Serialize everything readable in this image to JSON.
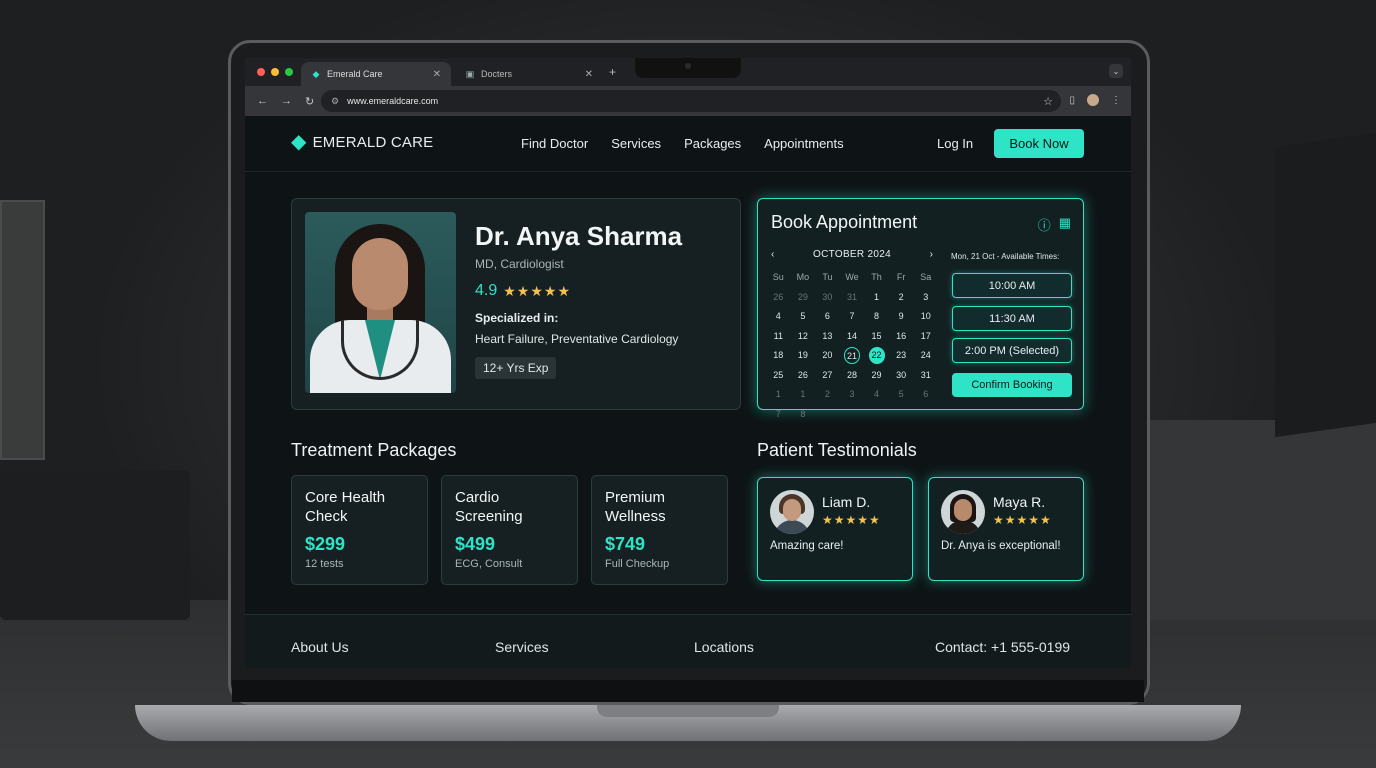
{
  "browser": {
    "tabs": [
      {
        "label": "Emerald Care",
        "active": true
      },
      {
        "label": "Docters",
        "active": false
      }
    ],
    "url": "www.emeraldcare.com"
  },
  "header": {
    "brand": "EMERALD CARE",
    "nav": [
      "Find Doctor",
      "Services",
      "Packages",
      "Appointments"
    ],
    "login": "Log In",
    "book_now": "Book Now"
  },
  "doctor": {
    "name": "Dr. Anya Sharma",
    "title": "MD, Cardiologist",
    "rating": "4.9",
    "stars": "★★★★★",
    "specialized_label": "Specialized in:",
    "specialized": "Heart Failure, Preventative Cardiology",
    "experience": "12+ Yrs Exp"
  },
  "booking": {
    "title": "Book Appointment",
    "month": "OCTOBER 2024",
    "weekdays": [
      "Su",
      "Mo",
      "Tu",
      "We",
      "Th",
      "Fr",
      "Sa"
    ],
    "days": [
      "26",
      "29",
      "30",
      "31",
      "1",
      "2",
      "3",
      "4",
      "5",
      "6",
      "7",
      "8",
      "9",
      "10",
      "11",
      "12",
      "13",
      "14",
      "15",
      "16",
      "17",
      "18",
      "19",
      "20",
      "21",
      "22",
      "23",
      "24",
      "25",
      "26",
      "27",
      "28",
      "29",
      "30",
      "31",
      "1",
      "1",
      "2",
      "3",
      "4",
      "5",
      "6",
      "7",
      "8"
    ],
    "today": "21",
    "selected": "22",
    "available_label": "Mon, 21 Oct - Available Times:",
    "slots": [
      "10:00 AM",
      "11:30 AM",
      "2:00 PM (Selected)"
    ],
    "confirm": "Confirm Booking"
  },
  "packages": {
    "title": "Treatment Packages",
    "items": [
      {
        "name": "Core Health Check",
        "price": "$299",
        "desc": "12 tests"
      },
      {
        "name": "Cardio Screening",
        "price": "$499",
        "desc": "ECG, Consult"
      },
      {
        "name": "Premium Wellness",
        "price": "$749",
        "desc": "Full Checkup"
      }
    ]
  },
  "testimonials": {
    "title": "Patient Testimonials",
    "items": [
      {
        "name": "Liam D.",
        "stars": "★★★★★",
        "quote": "Amazing care!"
      },
      {
        "name": "Maya R.",
        "stars": "★★★★★",
        "quote": "Dr. Anya is exceptional!"
      }
    ]
  },
  "footer": {
    "about": "About Us",
    "services": "Services",
    "locations": "Locations",
    "contact": "Contact: +1 555-0199"
  },
  "colors": {
    "accent": "#2fe3c7",
    "background": "#0e1416",
    "star": "#f2c14e"
  }
}
